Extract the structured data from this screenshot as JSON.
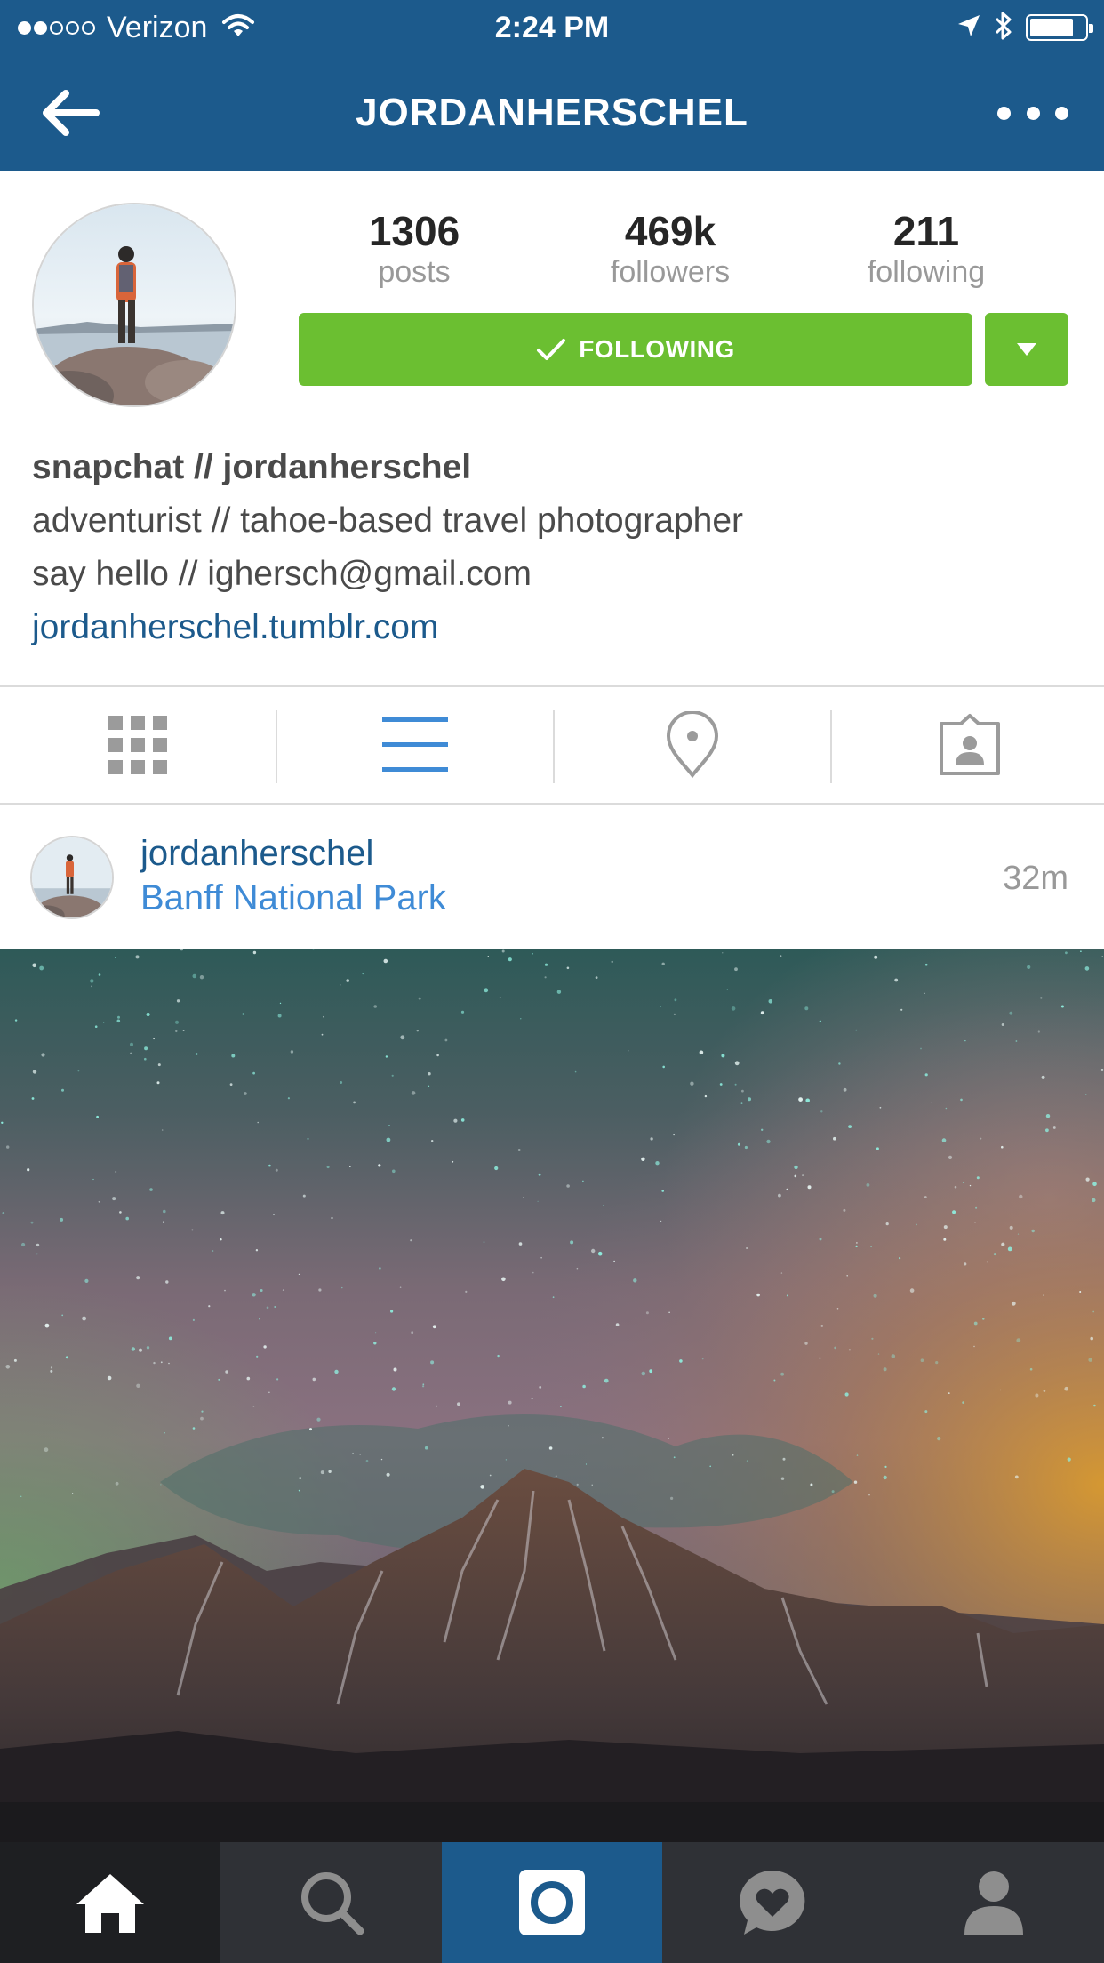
{
  "status": {
    "carrier": "Verizon",
    "time": "2:24 PM",
    "signal_bars": 2,
    "signal_total": 5
  },
  "nav": {
    "title": "JORDANHERSCHEL",
    "back_icon": "arrow-left-icon",
    "more_icon": "more-icon"
  },
  "profile": {
    "stats": [
      {
        "value": "1306",
        "label": "posts"
      },
      {
        "value": "469k",
        "label": "followers"
      },
      {
        "value": "211",
        "label": "following"
      }
    ],
    "follow_button": "FOLLOWING",
    "bio": {
      "name": "snapchat // jordanherschel",
      "line1": "adventurist // tahoe-based travel photographer",
      "line2": "say hello // ighersch@gmail.com",
      "link": "jordanherschel.tumblr.com"
    }
  },
  "view_tabs": [
    {
      "name": "grid-view",
      "icon": "grid-icon",
      "active": false
    },
    {
      "name": "list-view",
      "icon": "list-icon",
      "active": true
    },
    {
      "name": "places-view",
      "icon": "location-pin-icon",
      "active": false
    },
    {
      "name": "tagged-view",
      "icon": "tagged-photos-icon",
      "active": false
    }
  ],
  "post": {
    "username": "jordanherschel",
    "location": "Banff National Park",
    "time": "32m"
  },
  "tabbar": [
    {
      "name": "home",
      "icon": "home-icon",
      "active": true
    },
    {
      "name": "search",
      "icon": "search-icon",
      "active": false
    },
    {
      "name": "camera",
      "icon": "camera-icon",
      "active": false
    },
    {
      "name": "activity",
      "icon": "heart-bubble-icon",
      "active": false
    },
    {
      "name": "profile",
      "icon": "person-icon",
      "active": false
    }
  ],
  "colors": {
    "brand_blue": "#1c5a8c",
    "following_green": "#6bbf31",
    "link_blue": "#3f8bd6",
    "tabbar_dark": "#2f3136"
  }
}
